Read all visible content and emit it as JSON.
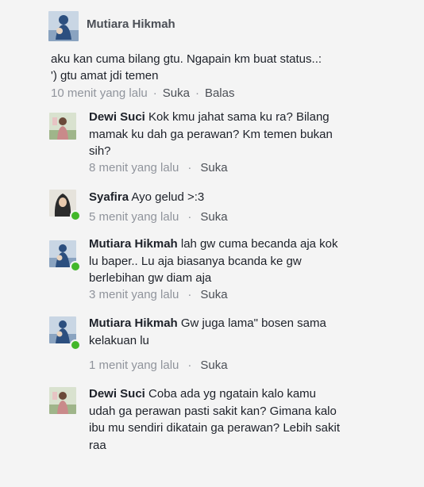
{
  "post": {
    "author": "Mutiara Hikmah",
    "text": "aku kan cuma bilang gtu. Ngapain km buat status..:\n') gtu amat jdi temen",
    "time": "10 menit yang lalu",
    "like_label": "Suka",
    "reply_label": "Balas",
    "avatar_icon": "profile-photo-mother-child"
  },
  "comments": [
    {
      "author": "Dewi Suci",
      "text": "Kok kmu jahat sama ku ra? Bilang mamak ku dah ga perawan?  Km temen bukan sih?",
      "time": "8 menit yang lalu",
      "like_label": "Suka",
      "online": false,
      "avatar_icon": "profile-photo-girl"
    },
    {
      "author": "Syafira",
      "text": "Ayo gelud >:3",
      "time": "5 menit yang lalu",
      "like_label": "Suka",
      "online": true,
      "avatar_icon": "profile-photo-hijab"
    },
    {
      "author": "Mutiara Hikmah",
      "text": "lah gw cuma becanda aja kok lu baper.. Lu aja biasanya bcanda ke gw berlebihan gw diam aja",
      "time": "3 menit yang lalu",
      "like_label": "Suka",
      "online": true,
      "avatar_icon": "profile-photo-mother-child"
    },
    {
      "author": "Mutiara Hikmah",
      "text": "Gw juga lama\" bosen sama kelakuan lu",
      "time": "1 menit yang lalu",
      "like_label": "Suka",
      "online": true,
      "avatar_icon": "profile-photo-mother-child"
    },
    {
      "author": "Dewi Suci",
      "text": "Coba ada yg ngatain kalo kamu udah ga perawan pasti sakit kan?  Gimana kalo ibu mu sendiri dikatain ga perawan? Lebih sakit raa",
      "online": false,
      "avatar_icon": "profile-photo-girl"
    }
  ],
  "colors": {
    "background": "#f4f4f4",
    "text": "#1d2129",
    "meta": "#90949c",
    "online": "#42b72a"
  }
}
